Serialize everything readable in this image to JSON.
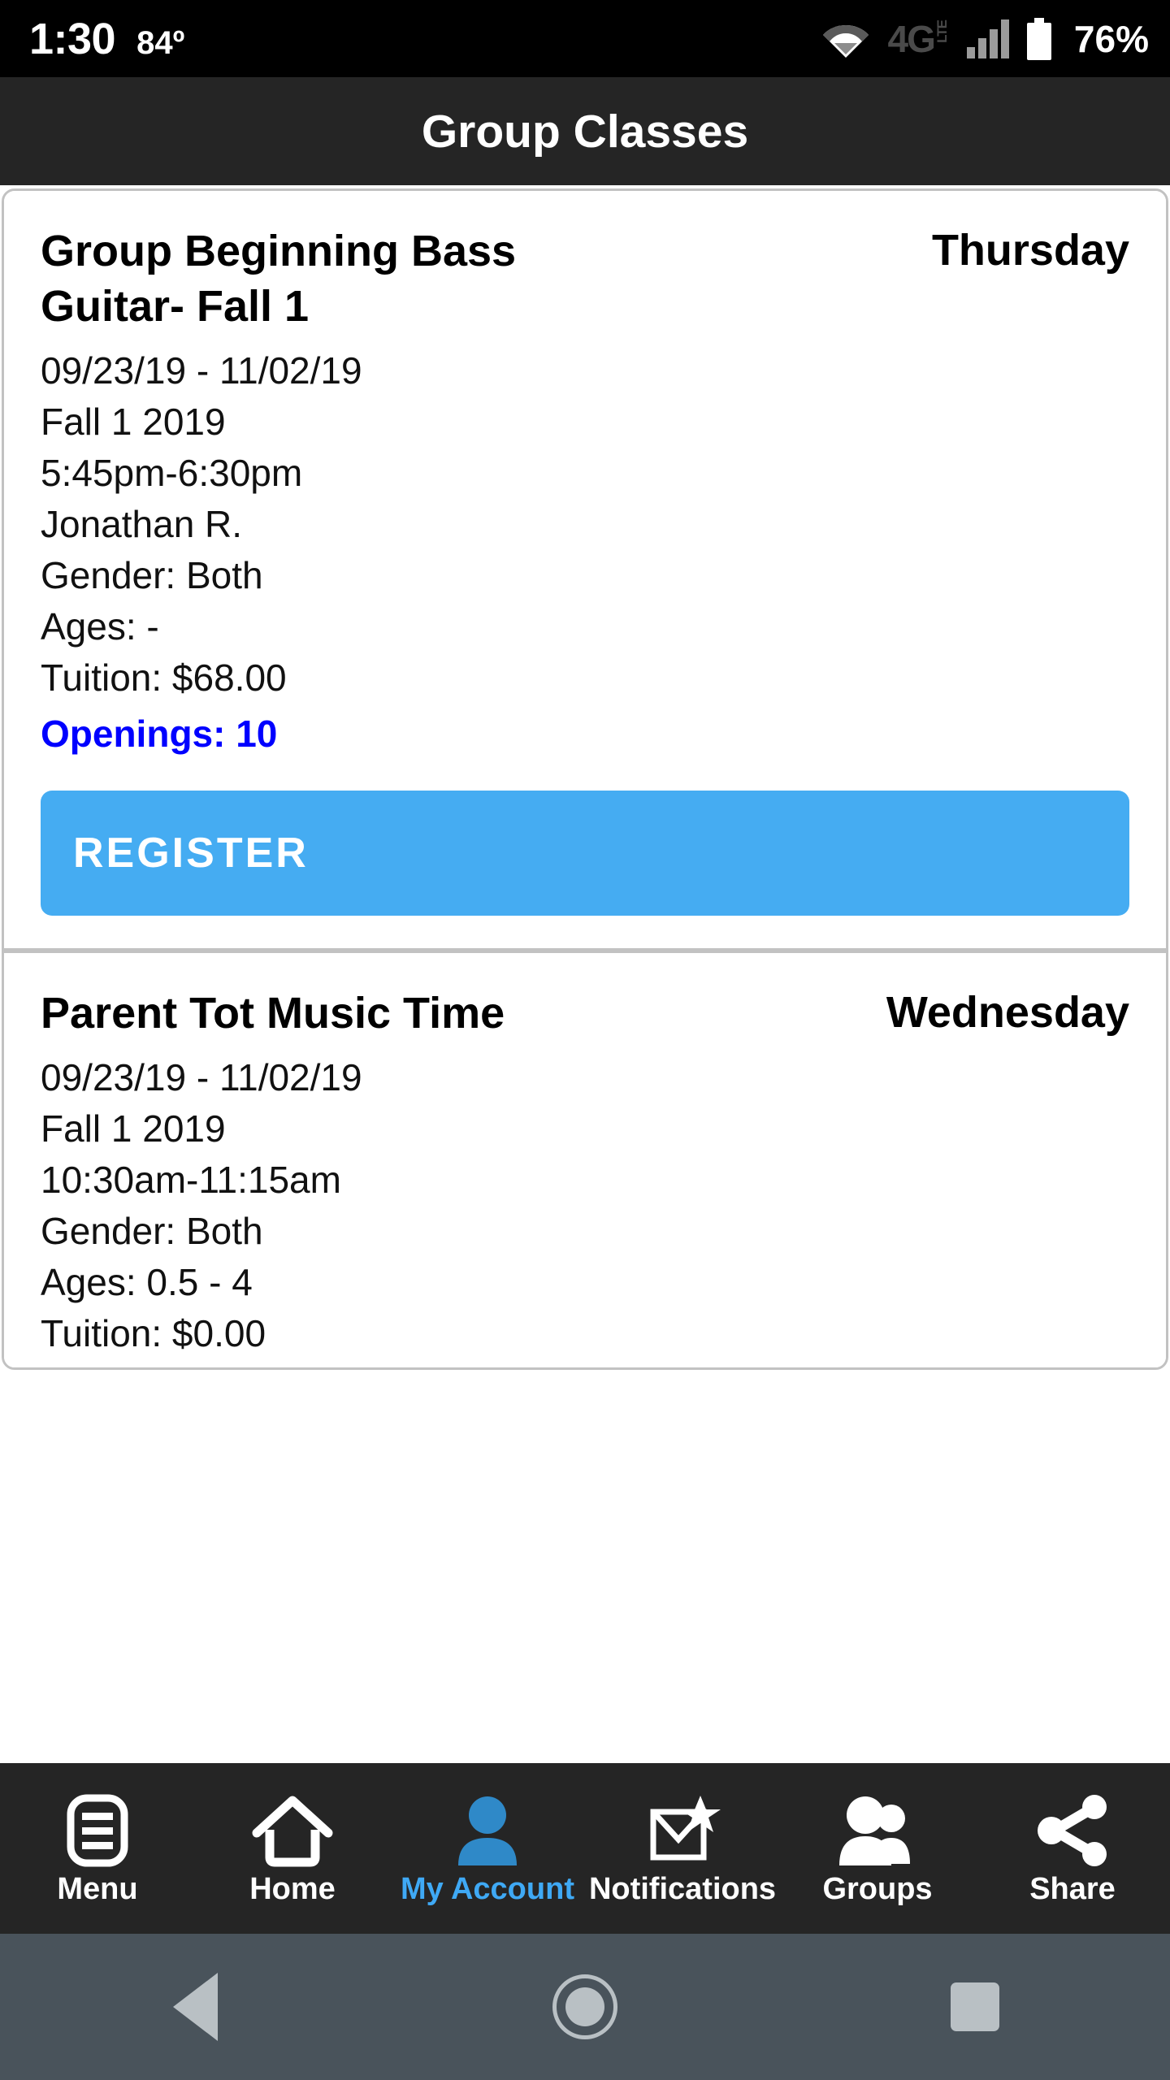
{
  "status_bar": {
    "time": "1:30",
    "temperature": "84º",
    "wifi_icon": "wifi-icon",
    "network_label": "4G",
    "network_sublabel": "LTE",
    "signal_icon": "signal-bars-icon",
    "battery_icon": "battery-icon",
    "battery_percent": "76%"
  },
  "app_header": {
    "title": "Group Classes"
  },
  "classes": [
    {
      "title": "Group Beginning Bass Guitar- Fall 1",
      "day": "Thursday",
      "date_range": "09/23/19 - 11/02/19",
      "session": "Fall 1 2019",
      "time": "5:45pm-6:30pm",
      "instructor": "Jonathan R.",
      "gender": "Gender: Both",
      "ages": "Ages: -",
      "tuition": "Tuition: $68.00",
      "openings": "Openings: 10",
      "openings_color": "#0000ff",
      "register_label": "REGISTER",
      "register_color": "#45acf2"
    },
    {
      "title": "Parent Tot Music Time",
      "day": "Wednesday",
      "date_range": "09/23/19 - 11/02/19",
      "session": "Fall 1 2019",
      "time": "10:30am-11:15am",
      "gender": "Gender: Both",
      "ages": "Ages: 0.5 - 4",
      "tuition": "Tuition: $0.00"
    }
  ],
  "tab_bar": {
    "active_color": "#3fa9f5",
    "items": [
      {
        "label": "Menu",
        "icon": "hamburger-menu-icon",
        "active": false
      },
      {
        "label": "Home",
        "icon": "house-icon",
        "active": false
      },
      {
        "label": "My Account",
        "icon": "person-icon",
        "active": true
      },
      {
        "label": "Notifications",
        "icon": "envelope-star-icon",
        "active": false
      },
      {
        "label": "Groups",
        "icon": "two-people-icon",
        "active": false
      },
      {
        "label": "Share",
        "icon": "share-nodes-icon",
        "active": false
      }
    ]
  },
  "android_nav": {
    "back": "back-triangle-icon",
    "home": "home-circle-icon",
    "recents": "recents-square-icon"
  }
}
